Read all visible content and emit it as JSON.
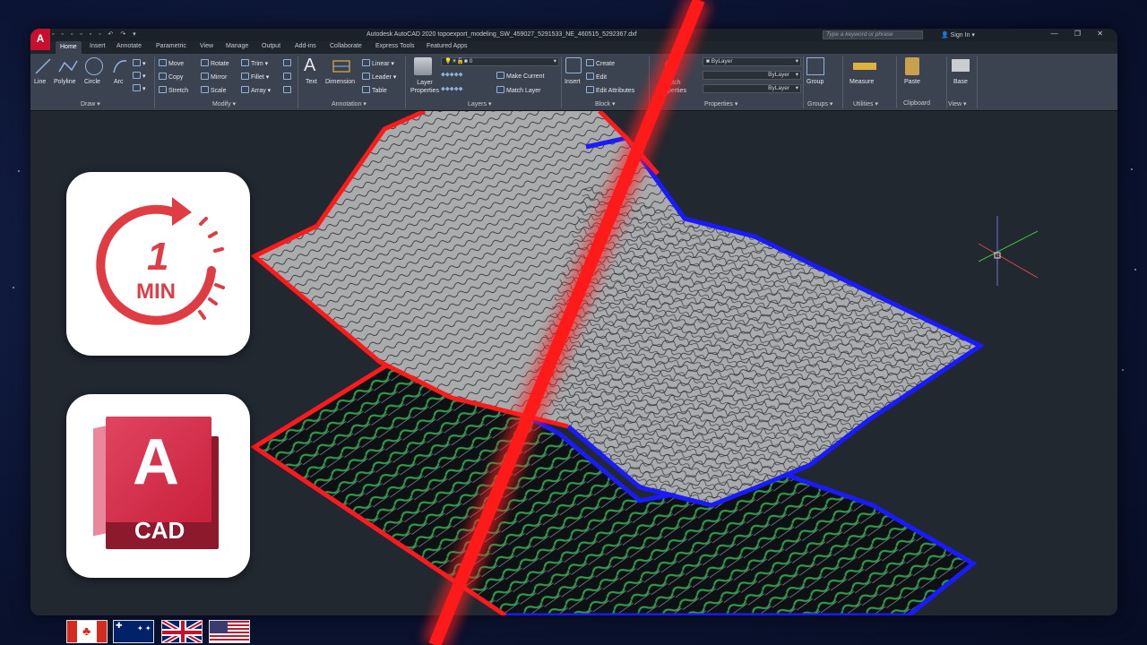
{
  "app": {
    "logo_letter": "A",
    "window_title": "Autodesk AutoCAD 2020   topoexport_modeling_SW_459027_5291533_NE_460515_5292367.dxf",
    "search_placeholder": "Type a keyword or phrase",
    "signin_label": "Sign In"
  },
  "tabs": [
    "Home",
    "Insert",
    "Annotate",
    "Parametric",
    "View",
    "Manage",
    "Output",
    "Add-ins",
    "Collaborate",
    "Express Tools",
    "Featured Apps"
  ],
  "active_tab": "Home",
  "ribbon": {
    "draw": {
      "line": "Line",
      "polyline": "Polyline",
      "circle": "Circle",
      "arc": "Arc",
      "panel": "Draw ▾"
    },
    "modify": {
      "move": "Move",
      "rotate": "Rotate",
      "trim": "Trim ▾",
      "copy": "Copy",
      "mirror": "Mirror",
      "fillet": "Fillet ▾",
      "stretch": "Stretch",
      "scale": "Scale",
      "array": "Array ▾",
      "panel": "Modify ▾"
    },
    "annotation": {
      "text": "Text",
      "dimension": "Dimension",
      "linear": "Linear ▾",
      "leader": "Leader ▾",
      "table": "Table",
      "panel": "Annotation ▾"
    },
    "layers": {
      "layer_properties": "Layer Properties",
      "current_layer": "0",
      "make_current": "Make Current",
      "match_layer": "Match Layer",
      "panel": "Layers ▾"
    },
    "block": {
      "insert": "Insert",
      "create": "Create",
      "edit": "Edit",
      "edit_attributes": "Edit Attributes",
      "panel": "Block ▾"
    },
    "properties": {
      "match": "Match Properties",
      "color": "ByLayer",
      "linetype": "ByLayer",
      "lineweight": "ByLayer",
      "panel": "Properties ▾"
    },
    "groups": {
      "group": "Group",
      "panel": "Groups ▾"
    },
    "utilities": {
      "measure": "Measure",
      "panel": "Utilities ▾"
    },
    "clipboard": {
      "paste": "Paste",
      "panel": "Clipboard"
    },
    "view": {
      "base": "Base",
      "panel": "View ▾"
    }
  },
  "overlay": {
    "timer_number": "1",
    "timer_unit": "MIN",
    "cad_letter": "A",
    "cad_label": "CAD"
  },
  "flags": [
    "canada-flag",
    "australia-flag",
    "uk-flag",
    "usa-flag"
  ],
  "colors": {
    "accent_red": "#ff1a1a",
    "boundary_blue": "#1a1aff",
    "autocad_red": "#c8102e",
    "ribbon_bg": "#3b4350"
  }
}
